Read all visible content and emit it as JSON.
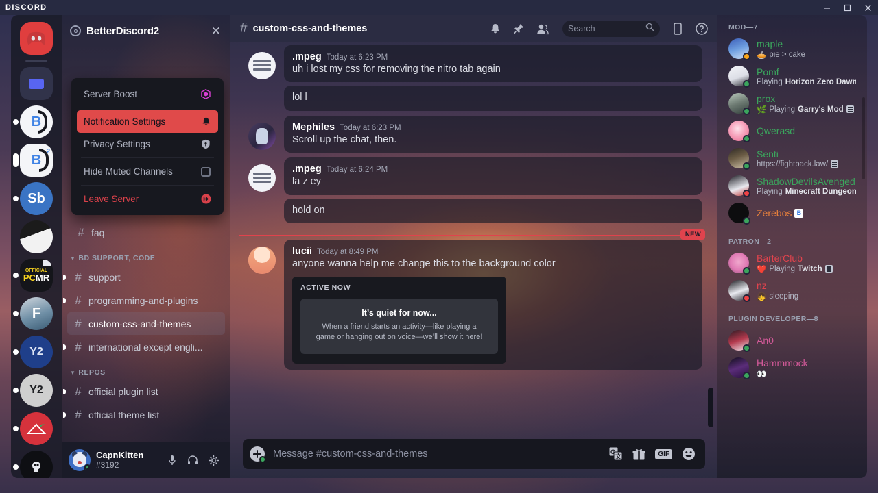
{
  "titlebar": {
    "brand": "DISCORD",
    "buttons": [
      {
        "name": "minimize-button",
        "glyph": "minimize"
      },
      {
        "name": "maximize-button",
        "glyph": "maximize"
      },
      {
        "name": "close-button",
        "glyph": "close"
      }
    ]
  },
  "guild_rail": {
    "items": [
      {
        "name": "home-button",
        "label": "Discord Home",
        "kind": "home",
        "pill": "none"
      },
      {
        "name": "guild-folder",
        "label": "Folder",
        "kind": "folder",
        "pill": "none"
      },
      {
        "name": "guild-betterdiscord",
        "label": "BD",
        "kind": "bd1",
        "pill": "dot"
      },
      {
        "name": "guild-betterdiscord2",
        "label": "BD2",
        "kind": "bd2",
        "pill": "tall"
      },
      {
        "name": "guild-sb",
        "label": "Sb",
        "kind": "sb",
        "pill": "dot"
      },
      {
        "name": "guild-dark",
        "label": "",
        "kind": "dark",
        "pill": "none"
      },
      {
        "name": "guild-pcmr",
        "label": "PCMR",
        "kind": "pcmr",
        "pill": "dot"
      },
      {
        "name": "guild-f",
        "label": "F",
        "kind": "f",
        "pill": "dot"
      },
      {
        "name": "guild-y2-blue",
        "label": "Y2",
        "kind": "y2blue",
        "pill": "dot"
      },
      {
        "name": "guild-y2-grey",
        "label": "Y2",
        "kind": "y2grey",
        "pill": "dot"
      },
      {
        "name": "guild-red-triangle",
        "label": "",
        "kind": "redtri",
        "pill": "dot"
      },
      {
        "name": "guild-skull",
        "label": "",
        "kind": "skull",
        "pill": "dot"
      }
    ]
  },
  "sidebar": {
    "guild_name": "BetterDiscord2",
    "close_label": "✕",
    "server_menu": [
      {
        "label": "Server Boost",
        "icon": "boost-icon",
        "state": "normal"
      },
      {
        "label": "Notification Settings",
        "icon": "bell-icon",
        "state": "active"
      },
      {
        "label": "Privacy Settings",
        "icon": "shield-icon",
        "state": "normal"
      },
      {
        "label": "Hide Muted Channels",
        "icon": "checkbox-icon",
        "state": "normal"
      },
      {
        "label": "Leave Server",
        "icon": "leave-icon",
        "state": "danger"
      }
    ],
    "channels": [
      {
        "type": "channel",
        "name": "faq",
        "selected": false,
        "unread": false
      },
      {
        "type": "category",
        "name": "BD SUPPORT, CODE"
      },
      {
        "type": "channel",
        "name": "support",
        "selected": false,
        "unread": true
      },
      {
        "type": "channel",
        "name": "programming-and-plugins",
        "selected": false,
        "unread": true
      },
      {
        "type": "channel",
        "name": "custom-css-and-themes",
        "selected": true,
        "unread": false
      },
      {
        "type": "channel",
        "name": "international except engli...",
        "selected": false,
        "unread": true
      },
      {
        "type": "category",
        "name": "REPOS"
      },
      {
        "type": "channel",
        "name": "official plugin list",
        "selected": false,
        "unread": true
      },
      {
        "type": "channel",
        "name": "official theme list",
        "selected": false,
        "unread": true
      }
    ]
  },
  "user_panel": {
    "username": "CapnKitten",
    "discriminator": "#3192",
    "status": "online",
    "icons": [
      {
        "name": "mute-microphone-button",
        "label": "mic-icon"
      },
      {
        "name": "deafen-button",
        "label": "headphones-icon"
      },
      {
        "name": "user-settings-button",
        "label": "gear-icon"
      }
    ]
  },
  "channel_header": {
    "hash": "#",
    "title": "custom-css-and-themes",
    "tools": [
      {
        "name": "notification-settings-icon",
        "label": "bell-icon"
      },
      {
        "name": "pinned-messages-icon",
        "label": "pin-icon"
      },
      {
        "name": "member-list-icon",
        "label": "people-icon"
      },
      {
        "name": "inbox-icon",
        "label": "inbox-icon"
      },
      {
        "name": "help-icon",
        "label": "help-icon"
      }
    ]
  },
  "search": {
    "placeholder": "Search"
  },
  "messages": [
    {
      "author": ".mpeg",
      "avatar": "mpeg",
      "timestamp": "Today at 6:23 PM",
      "lines": [
        "uh i  lost my css for removing the nitro tab again",
        "lol l"
      ]
    },
    {
      "author": "Mephiles",
      "avatar": "mephiles",
      "timestamp": "Today at 6:23 PM",
      "lines": [
        "Scroll up the chat, then."
      ]
    },
    {
      "author": ".mpeg",
      "avatar": "mpeg",
      "timestamp": "Today at 6:24 PM",
      "lines": [
        "la z ey",
        "hold on"
      ]
    }
  ],
  "new_divider": {
    "label": "NEW"
  },
  "new_message": {
    "author": "lucii",
    "avatar": "lucii",
    "timestamp": "Today at 8:49 PM",
    "text": "anyone wanna help me change this to the background color",
    "embed": {
      "title": "ACTIVE NOW",
      "card_title": "It’s quiet for now...",
      "card_body": "When a friend starts an activity—like playing a game or hanging out on voice—we’ll show it here!"
    }
  },
  "composer": {
    "placeholder": "Message #custom-css-and-themes",
    "icons": [
      {
        "name": "translate-icon",
        "label": "translate"
      },
      {
        "name": "gift-icon",
        "label": "gift"
      },
      {
        "name": "gif-button",
        "label": "GIF"
      },
      {
        "name": "emoji-icon",
        "label": "emoji"
      }
    ]
  },
  "members": {
    "groups": [
      {
        "title": "MOD—7",
        "people": [
          {
            "name": "maple",
            "color": "#3ba55d",
            "status_text": "pie > cake",
            "status_emoji": "🥧",
            "presence": "idle",
            "avatar": "maple",
            "bold_part": "",
            "badge": ""
          },
          {
            "name": "Pomf",
            "color": "#3ba55d",
            "status_text": "Playing ",
            "bold_part": "Horizon Zero Dawn",
            "presence": "online",
            "avatar": "pomf",
            "badge": ""
          },
          {
            "name": "prox",
            "color": "#3ba55d",
            "status_text": "Playing ",
            "bold_part": "Garry's Mod",
            "status_emoji": "🌿",
            "presence": "online",
            "avatar": "prox",
            "badge": "tag"
          },
          {
            "name": "Qwerasd",
            "color": "#3ba55d",
            "status_text": "",
            "bold_part": "",
            "presence": "online",
            "avatar": "qwerasd",
            "badge": ""
          },
          {
            "name": "Senti",
            "color": "#3ba55d",
            "status_text": "https://fightback.law/",
            "bold_part": "",
            "presence": "online",
            "avatar": "senti",
            "badge": "tag"
          },
          {
            "name": "ShadowDevilsAvenged",
            "color": "#3ba55d",
            "status_text": "Playing ",
            "bold_part": "Minecraft Dungeons - ...",
            "presence": "dnd",
            "avatar": "shadow",
            "badge": ""
          },
          {
            "name": "Zerebos",
            "color": "#e8803c",
            "status_text": "",
            "bold_part": "",
            "presence": "online",
            "avatar": "zerebos",
            "badge": "bd"
          }
        ]
      },
      {
        "title": "PATRON—2",
        "people": [
          {
            "name": "BarterClub",
            "color": "#e0434d",
            "status_text": "Playing ",
            "bold_part": "Twitch",
            "status_emoji": "❤️",
            "presence": "online",
            "avatar": "barter",
            "badge": "tag"
          },
          {
            "name": "nz",
            "color": "#e0434d",
            "status_text": "sleeping",
            "bold_part": "",
            "status_emoji": "👧",
            "presence": "dnd",
            "avatar": "nz",
            "badge": ""
          }
        ]
      },
      {
        "title": "PLUGIN DEVELOPER—8",
        "people": [
          {
            "name": "An0",
            "color": "#d45a9a",
            "status_text": "",
            "bold_part": "",
            "presence": "online",
            "avatar": "an0",
            "badge": ""
          },
          {
            "name": "Hammmock",
            "color": "#d45a9a",
            "status_text": "👀",
            "bold_part": "",
            "presence": "online",
            "avatar": "hammock",
            "badge": ""
          }
        ]
      }
    ]
  }
}
